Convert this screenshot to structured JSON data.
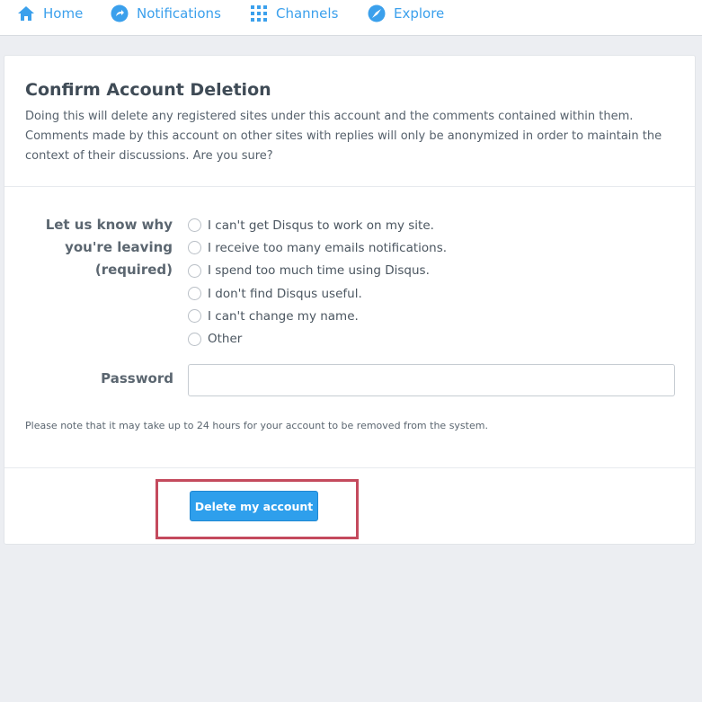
{
  "nav": {
    "home": "Home",
    "notifications": "Notifications",
    "channels": "Channels",
    "explore": "Explore"
  },
  "card": {
    "title": "Confirm Account Deletion",
    "description": "Doing this will delete any registered sites under this account and the comments contained within them. Comments made by this account on other sites with replies will only be anonymized in order to maintain the context of their discussions. Are you sure?",
    "reason_label": "Let us know why you're leaving (required)",
    "reasons": [
      "I can't get Disqus to work on my site.",
      "I receive too many emails notifications.",
      "I spend too much time using Disqus.",
      "I don't find Disqus useful.",
      "I can't change my name.",
      "Other"
    ],
    "password_label": "Password",
    "password_value": "",
    "note": "Please note that it may take up to 24 hours for your account to be removed from the system.",
    "delete_button": "Delete my account"
  },
  "colors": {
    "accent": "#3ba0ec",
    "button": "#2e9fec",
    "highlight": "#c44a5d",
    "background": "#eceef2"
  },
  "icons": {
    "home": "home-icon",
    "notifications": "notifications-icon",
    "channels": "grid-icon",
    "explore": "compass-icon"
  }
}
